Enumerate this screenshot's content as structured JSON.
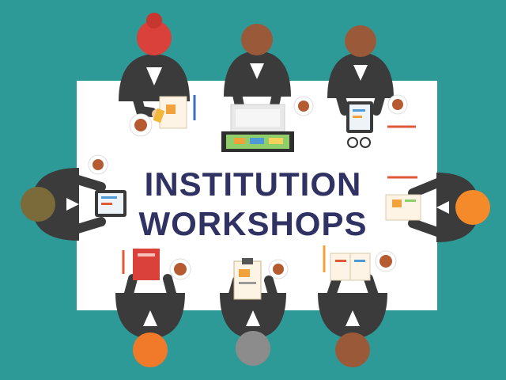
{
  "title": {
    "line1": "INSTITUTION",
    "line2": "WORKSHOPS"
  },
  "colors": {
    "background": "#2e9a98",
    "table": "#ffffff",
    "title_text": "#2f3263",
    "suit": "#3b3b3b",
    "skin": "#f4c9a2"
  },
  "people": [
    {
      "hair": "red-bun"
    },
    {
      "hair": "brown"
    },
    {
      "hair": "brown"
    },
    {
      "hair": "olive"
    },
    {
      "hair": "orange"
    },
    {
      "hair": "orange"
    },
    {
      "hair": "gray"
    },
    {
      "hair": "brown"
    }
  ]
}
